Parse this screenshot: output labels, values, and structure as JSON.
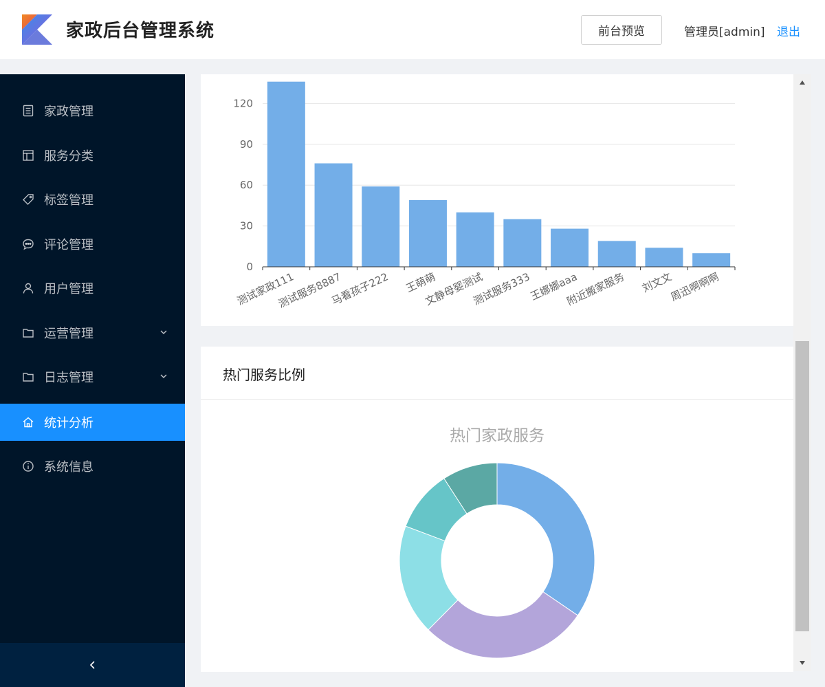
{
  "header": {
    "title": "家政后台管理系统",
    "preview_button": "前台预览",
    "admin": "管理员[admin]",
    "logout": "退出"
  },
  "sidebar": {
    "items": [
      {
        "label": "家政管理",
        "icon": "list-icon"
      },
      {
        "label": "服务分类",
        "icon": "layout-icon"
      },
      {
        "label": "标签管理",
        "icon": "tag-icon"
      },
      {
        "label": "评论管理",
        "icon": "comment-icon"
      },
      {
        "label": "用户管理",
        "icon": "user-icon"
      },
      {
        "label": "运营管理",
        "icon": "folder-icon",
        "expandable": true
      },
      {
        "label": "日志管理",
        "icon": "folder-icon",
        "expandable": true
      },
      {
        "label": "统计分析",
        "icon": "home-icon",
        "active": true
      },
      {
        "label": "系统信息",
        "icon": "info-icon"
      }
    ],
    "collapse_icon": "chevron-left-icon"
  },
  "pie_section": {
    "title": "热门服务比例",
    "chart_title": "热门家政服务"
  },
  "colors": {
    "header_bg": "#ffffff",
    "sidebar_bg": "#001529",
    "active": "#1890ff",
    "bar": "#73aee8",
    "link": "#1890ff"
  },
  "chart_data": [
    {
      "type": "bar",
      "categories": [
        "测试家政111",
        "测试服务8887",
        "马看孩子222",
        "王萌萌",
        "文静母婴测试",
        "测试服务333",
        "王娜娜aaa",
        "附近搬家服务",
        "刘文文",
        "周迅啊啊啊"
      ],
      "values": [
        136,
        76,
        59,
        49,
        40,
        35,
        28,
        19,
        14,
        10
      ],
      "yticks": [
        0,
        30,
        60,
        90,
        120
      ],
      "ylim": [
        0,
        140
      ],
      "color": "#73aee8",
      "grid": true
    },
    {
      "type": "pie",
      "title": "热门家政服务",
      "donut": true,
      "slices": [
        {
          "value": 136,
          "color": "#73aee8"
        },
        {
          "value": 110,
          "color": "#b3a5da"
        },
        {
          "value": 72,
          "color": "#8ddfe6"
        },
        {
          "value": 40,
          "color": "#66c5c8"
        },
        {
          "value": 36,
          "color": "#5ba8a4"
        }
      ]
    }
  ]
}
